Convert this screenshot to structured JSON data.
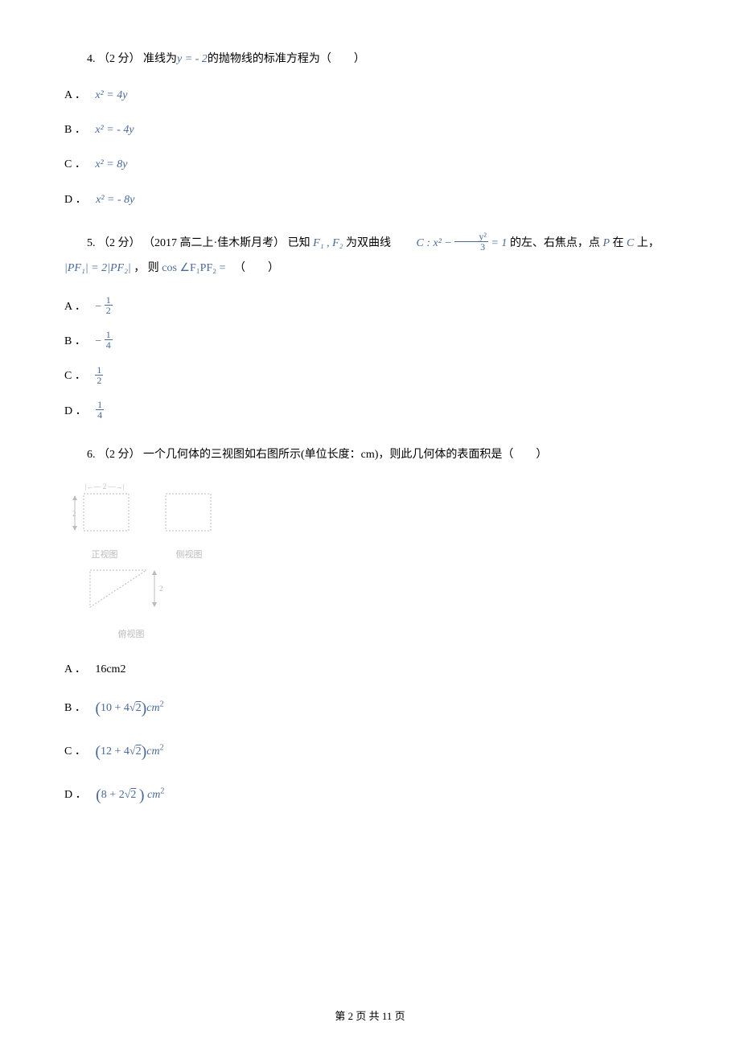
{
  "q4": {
    "number": "4.",
    "points": "（2 分）",
    "pre_text": " 准线为",
    "formula_inline": "y = - 2",
    "post_text": "的抛物线的标准方程为（　　）",
    "options": {
      "A": {
        "label": "A ．",
        "formula": "x² = 4y"
      },
      "B": {
        "label": "B ．",
        "formula": "x² = - 4y"
      },
      "C": {
        "label": "C ．",
        "formula": "x² = 8y"
      },
      "D": {
        "label": "D ．",
        "formula": "x² = - 8y"
      }
    }
  },
  "q5": {
    "number": "5.",
    "points": "（2 分）",
    "source": "（2017 高二上·佳木斯月考）",
    "pre_text": " 已知 ",
    "f1f2": "F₁ , F₂",
    "mid_text": " 为双曲线 ",
    "curve_prefix": "C : x² − ",
    "frac_num": "y²",
    "frac_den": "3",
    "curve_suffix": " = 1",
    "post_text": " 的左、右焦点，点 ",
    "point_p": "P",
    "post_text2": " 在 ",
    "curve_c": "C",
    "post_text3": " 上，",
    "line2_pre": "|PF₁| = 2|PF₂|",
    "line2_mid": " ， 则 ",
    "cos_expr": "cos ∠F₁PF₂ =",
    "line2_post": "　（　　）",
    "options": {
      "A": {
        "label": "A ．",
        "neg": "−",
        "num": "1",
        "den": "2"
      },
      "B": {
        "label": "B ．",
        "neg": "−",
        "num": "1",
        "den": "4"
      },
      "C": {
        "label": "C ．",
        "neg": "",
        "num": "1",
        "den": "2"
      },
      "D": {
        "label": "D ．",
        "neg": "",
        "num": "1",
        "den": "4"
      }
    }
  },
  "q6": {
    "number": "6.",
    "points": "（2 分）",
    "text": " 一个几何体的三视图如右图所示(单位长度：cm)，则此几何体的表面积是（　　）",
    "views": {
      "front": "正视图",
      "side": "侧视图",
      "top": "俯视图",
      "dim_top": "2",
      "dim_left": "2",
      "dim_right": "2"
    },
    "options": {
      "A": {
        "label": "A ．",
        "text": "16cm2"
      },
      "B": {
        "label": "B ．",
        "expr": "(10 + 4√2)cm²"
      },
      "C": {
        "label": "C ．",
        "expr": "(12 + 4√2)cm²"
      },
      "D": {
        "label": "D ．",
        "expr": "(8 + 2√2) cm²"
      }
    }
  },
  "footer": "第 2 页 共 11 页"
}
